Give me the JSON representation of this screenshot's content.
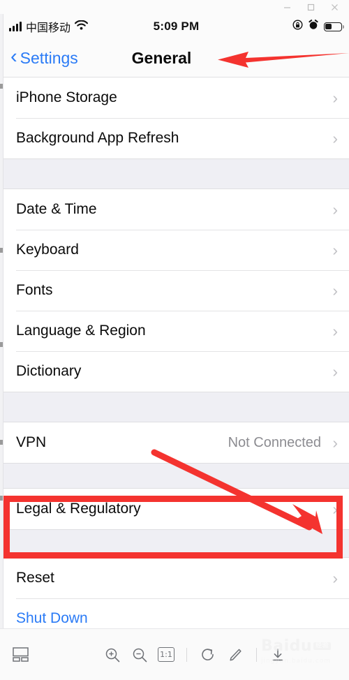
{
  "window": {
    "controls": [
      {
        "name": "minimize",
        "glyph": "–"
      },
      {
        "name": "maximize",
        "glyph": "□"
      },
      {
        "name": "close",
        "glyph": "✕"
      }
    ]
  },
  "statusbar": {
    "carrier": "中国移动",
    "time": "5:09 PM",
    "signal_icon": "signal-bars-icon",
    "wifi_icon": "wifi-icon",
    "rotation_lock_icon": "rotation-lock-icon",
    "alarm_icon": "alarm-clock-icon",
    "battery_icon": "battery-icon"
  },
  "navbar": {
    "back_label": "Settings",
    "back_icon": "chevron-left-icon",
    "title": "General"
  },
  "groups": [
    {
      "rows": [
        {
          "label": "iPhone Storage",
          "value": "",
          "accessory": "chevron-right-icon",
          "style": "default"
        },
        {
          "label": "Background App Refresh",
          "value": "",
          "accessory": "chevron-right-icon",
          "style": "default"
        }
      ]
    },
    {
      "rows": [
        {
          "label": "Date & Time",
          "value": "",
          "accessory": "chevron-right-icon",
          "style": "default"
        },
        {
          "label": "Keyboard",
          "value": "",
          "accessory": "chevron-right-icon",
          "style": "default"
        },
        {
          "label": "Fonts",
          "value": "",
          "accessory": "chevron-right-icon",
          "style": "default"
        },
        {
          "label": "Language & Region",
          "value": "",
          "accessory": "chevron-right-icon",
          "style": "default"
        },
        {
          "label": "Dictionary",
          "value": "",
          "accessory": "chevron-right-icon",
          "style": "default"
        }
      ]
    },
    {
      "rows": [
        {
          "label": "VPN",
          "value": "Not Connected",
          "accessory": "chevron-right-icon",
          "style": "default"
        }
      ]
    },
    {
      "rows": [
        {
          "label": "Legal & Regulatory",
          "value": "",
          "accessory": "chevron-right-icon",
          "style": "default"
        }
      ]
    },
    {
      "rows": [
        {
          "label": "Reset",
          "value": "",
          "accessory": "chevron-right-icon",
          "style": "default"
        },
        {
          "label": "Shut Down",
          "value": "",
          "accessory": "",
          "style": "blue"
        }
      ]
    }
  ],
  "annotations": {
    "highlight_color": "#f4332f",
    "arrow_to_title": "red-arrow-left",
    "arrow_to_legal": "red-arrow-diagonal",
    "highlight_box_target": "Legal & Regulatory"
  },
  "toolbar": {
    "layout_icon": "page-layout-icon",
    "zoom_in_icon": "zoom-in-icon",
    "zoom_out_icon": "zoom-out-icon",
    "actual_size_label": "1:1",
    "rotate_icon": "rotate-right-icon",
    "edit_icon": "pencil-edit-icon",
    "download_icon": "download-icon"
  },
  "watermark": {
    "main": "Baidu",
    "badge": "经验",
    "sub": "jingyan.baidu.com"
  }
}
